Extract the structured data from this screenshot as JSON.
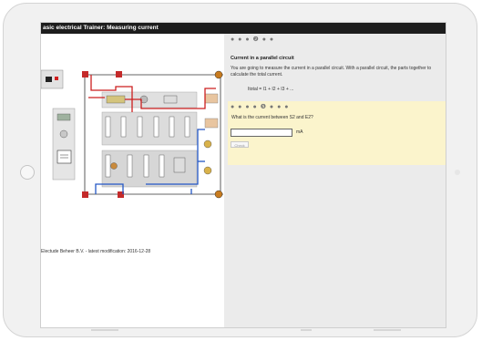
{
  "window": {
    "title": "asic electrical Trainer: Measuring current"
  },
  "footer": {
    "text": "Electude Beheer B.V. - latest modification: 2016-12-28"
  },
  "section1": {
    "dots": "● ● ● ❷ ● ●",
    "title": "Current in a parallel circuit",
    "text": "You are going to measure the current in a parallel circuit. With a parallel circuit, the parts together to calculate the total current.",
    "formula": "Itotal = I1 + I2 + I3 + ..."
  },
  "section2": {
    "dots": "● ● ● ● ❺ ● ● ●",
    "question": "What is the current between S2 and E2?",
    "input_value": "",
    "unit": "mA",
    "check_label": "Check"
  },
  "colors": {
    "titlebar": "#1d1d1d",
    "question_bg": "#fbf4cc",
    "right_panel_bg": "#ebebeb",
    "wire_red": "#cc1f1f",
    "wire_blue": "#2457c5"
  }
}
